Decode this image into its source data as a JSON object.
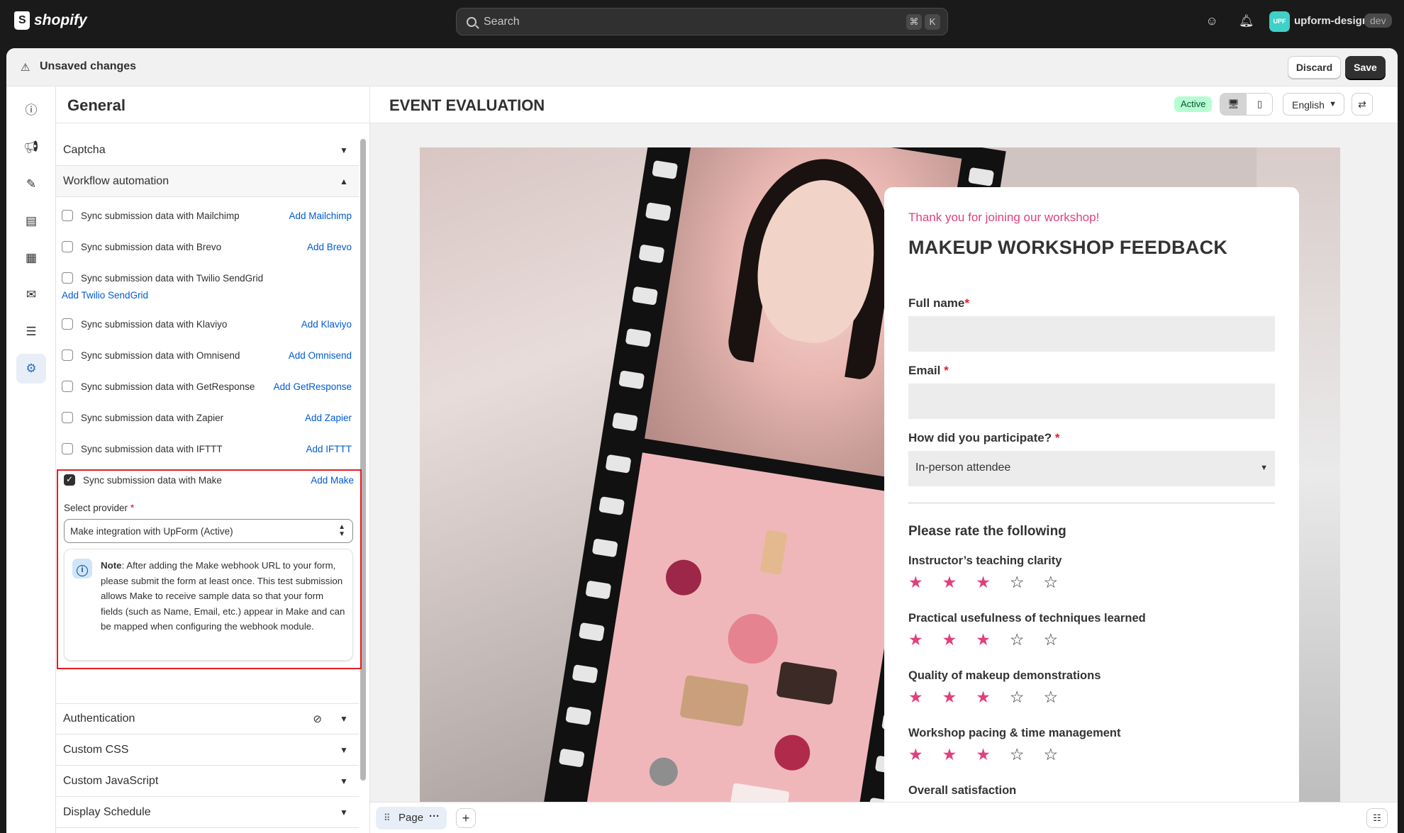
{
  "topbar": {
    "brand": "shopify",
    "search_placeholder": "Search",
    "kbd1": "⌘",
    "kbd2": "K",
    "avatar_text": "UPF",
    "store_name": "upform-design",
    "dev_badge": "dev"
  },
  "save_bar": {
    "title": "Unsaved changes",
    "discard": "Discard",
    "save": "Save"
  },
  "rail_icons": [
    "info-icon",
    "megaphone-icon",
    "brush-icon",
    "blocks-icon",
    "form-icon",
    "mail-icon",
    "filter-icon",
    "gear-icon"
  ],
  "panel": {
    "title": "General",
    "captcha": "Captcha",
    "workflow": "Workflow automation",
    "integrations": [
      {
        "label": "Sync submission data with Mailchimp",
        "link": "Add Mailchimp",
        "checked": false
      },
      {
        "label": "Sync submission data with Brevo",
        "link": "Add Brevo",
        "checked": false
      },
      {
        "label": "Sync submission data with Twilio SendGrid",
        "link": "Add Twilio SendGrid",
        "checked": false
      },
      {
        "label": "Sync submission data with Klaviyo",
        "link": "Add Klaviyo",
        "checked": false
      },
      {
        "label": "Sync submission data with Omnisend",
        "link": "Add Omnisend",
        "checked": false
      },
      {
        "label": "Sync submission data with GetResponse",
        "link": "Add GetResponse",
        "checked": false
      },
      {
        "label": "Sync submission data with Zapier",
        "link": "Add Zapier",
        "checked": false
      },
      {
        "label": "Sync submission data with IFTTT",
        "link": "Add IFTTT",
        "checked": false
      },
      {
        "label": "Sync submission data with Make",
        "link": "Add Make",
        "checked": true
      }
    ],
    "select_provider_label": "Select provider",
    "select_provider_value": "Make integration with UpForm (Active)",
    "note_bold": "Note",
    "note_text": ": After adding the Make webhook URL to your form, please submit the form at least once. This test submission allows Make to receive sample data so that your form fields (such as Name, Email, etc.) appear in Make and can be mapped when configuring the webhook module.",
    "authentication": "Authentication",
    "custom_css": "Custom CSS",
    "custom_js": "Custom JavaScript",
    "display_schedule": "Display Schedule"
  },
  "canvas_header": {
    "title": "EVENT EVALUATION",
    "status": "Active",
    "language": "English"
  },
  "form": {
    "thank_you": "Thank you for joining our workshop!",
    "title": "MAKEUP WORKSHOP FEEDBACK",
    "full_name_label": "Full name",
    "email_label": "Email",
    "participate_label": "How did you participate?",
    "participate_value": "In-person attendee",
    "rating_section": "Please rate the following",
    "ratings": [
      {
        "question": "Instructor’s teaching clarity",
        "stars": 3,
        "max": 5
      },
      {
        "question": "Practical usefulness of techniques learned",
        "stars": 3,
        "max": 5
      },
      {
        "question": "Quality of makeup demonstrations",
        "stars": 3,
        "max": 5
      },
      {
        "question": "Workshop pacing & time management",
        "stars": 3,
        "max": 5
      }
    ],
    "overall": "Overall satisfaction"
  },
  "bottom_bar": {
    "page_label": "Page"
  }
}
